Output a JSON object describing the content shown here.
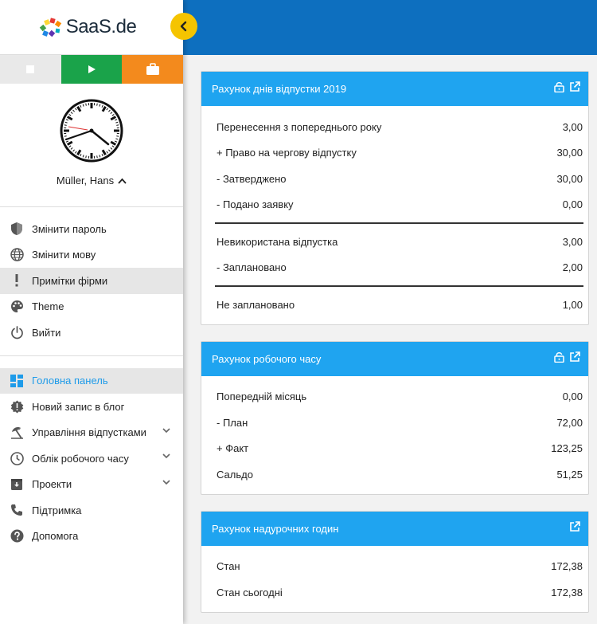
{
  "logo": {
    "text": "SaaS",
    "suffix": ".de"
  },
  "user": {
    "name": "Müller, Hans"
  },
  "menu_top": [
    {
      "label": "Змінити пароль",
      "icon": "shield-icon"
    },
    {
      "label": "Змінити мову",
      "icon": "globe-icon"
    },
    {
      "label": "Примітки фірми",
      "icon": "exclamation-icon"
    },
    {
      "label": "Theme",
      "icon": "palette-icon"
    },
    {
      "label": "Вийти",
      "icon": "power-icon"
    }
  ],
  "menu_main": [
    {
      "label": "Головна панель",
      "icon": "dashboard-icon"
    },
    {
      "label": "Новий запис в блог",
      "icon": "badge-alert-icon"
    },
    {
      "label": "Управління відпустками",
      "icon": "beach-umbrella-icon"
    },
    {
      "label": "Облік робочого часу",
      "icon": "clock-icon"
    },
    {
      "label": "Проекти",
      "icon": "archive-icon"
    },
    {
      "label": "Підтримка",
      "icon": "phone-icon"
    },
    {
      "label": "Допомога",
      "icon": "help-icon"
    }
  ],
  "cards": [
    {
      "title": "Рахунок днів відпустки 2019",
      "rows": [
        {
          "label": "Перенесення з попереднього року",
          "value": "3,00"
        },
        {
          "label": "+ Право на чергову відпустку",
          "value": "30,00"
        },
        {
          "label": "- Затверджено",
          "value": "30,00"
        },
        {
          "label": "- Подано заявку",
          "value": "0,00"
        },
        {
          "label": "Невикористана відпустка",
          "value": "3,00"
        },
        {
          "label": "- Заплановано",
          "value": "2,00"
        },
        {
          "label": "Не заплановано",
          "value": "1,00"
        }
      ]
    },
    {
      "title": "Рахунок робочого часу",
      "rows": [
        {
          "label": "Попередній місяць",
          "value": "0,00"
        },
        {
          "label": "- План",
          "value": "72,00"
        },
        {
          "label": "+ Факт",
          "value": "123,25"
        },
        {
          "label": "Сальдо",
          "value": "51,25"
        }
      ]
    },
    {
      "title": "Рахунок надурочних годин",
      "rows": [
        {
          "label": "Стан",
          "value": "172,38"
        },
        {
          "label": "Стан сьогодні",
          "value": "172,38"
        }
      ]
    }
  ],
  "colors": {
    "topbar": "#0d6fbf",
    "card_header": "#1fa4f0",
    "accent_active": "#1e9be9",
    "play": "#1aa34a",
    "work": "#f38a1d",
    "collapse": "#f5c400"
  }
}
